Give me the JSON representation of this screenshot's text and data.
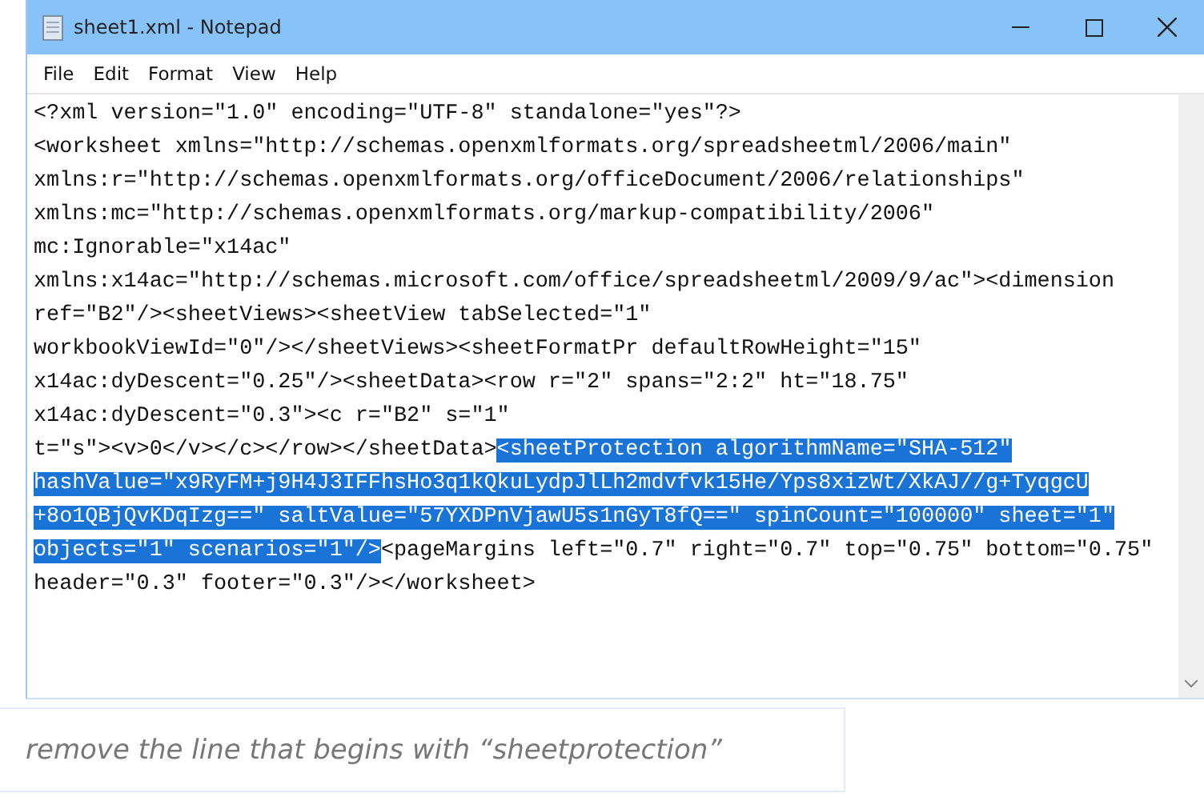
{
  "window": {
    "title": "sheet1.xml - Notepad"
  },
  "menu": [
    "File",
    "Edit",
    "Format",
    "View",
    "Help"
  ],
  "lines": [
    [
      {
        "text": "<?xml version=\"1.0\" encoding=\"UTF-8\" standalone=\"yes\"?>",
        "selected": false
      }
    ],
    [
      {
        "text": "<worksheet xmlns=\"http://schemas.openxmlformats.org/spreadsheetml/2006/main\"",
        "selected": false
      }
    ],
    [
      {
        "text": "xmlns:r=\"http://schemas.openxmlformats.org/officeDocument/2006/relationships\"",
        "selected": false
      }
    ],
    [
      {
        "text": "xmlns:mc=\"http://schemas.openxmlformats.org/markup-compatibility/2006\"",
        "selected": false
      }
    ],
    [
      {
        "text": "mc:Ignorable=\"x14ac\"",
        "selected": false
      }
    ],
    [
      {
        "text": "xmlns:x14ac=\"http://schemas.microsoft.com/office/spreadsheetml/2009/9/ac\"><dimension",
        "selected": false
      }
    ],
    [
      {
        "text": "ref=\"B2\"/><sheetViews><sheetView tabSelected=\"1\"",
        "selected": false
      }
    ],
    [
      {
        "text": "workbookViewId=\"0\"/></sheetViews><sheetFormatPr defaultRowHeight=\"15\"",
        "selected": false
      }
    ],
    [
      {
        "text": "x14ac:dyDescent=\"0.25\"/><sheetData><row r=\"2\" spans=\"2:2\" ht=\"18.75\"",
        "selected": false
      }
    ],
    [
      {
        "text": "x14ac:dyDescent=\"0.3\"><c r=\"B2\" s=\"1\"",
        "selected": false
      }
    ],
    [
      {
        "text": "t=\"s\"><v>0</v></c></row></sheetData>",
        "selected": false
      },
      {
        "text": "<sheetProtection algorithmName=\"SHA-512\"",
        "selected": true
      }
    ],
    [
      {
        "text": "hashValue=\"x9RyFM+j9H4J3IFFhsHo3q1kQkuLydpJlLh2mdvfvk15He/Yps8xizWt/XkAJ//g+TyqgcU",
        "selected": true
      }
    ],
    [
      {
        "text": "+8o1QBjQvKDqIzg==\" saltValue=\"57YXDPnVjawU5s1nGyT8fQ==\" spinCount=\"100000\" sheet=\"1\"",
        "selected": true
      }
    ],
    [
      {
        "text": "objects=\"1\" scenarios=\"1\"/>",
        "selected": true
      },
      {
        "text": "<pageMargins left=\"0.7\" right=\"0.7\" top=\"0.75\" bottom=\"0.75\"",
        "selected": false
      }
    ],
    [
      {
        "text": "header=\"0.3\" footer=\"0.3\"/></worksheet>",
        "selected": false
      }
    ]
  ],
  "caption": "remove the line that begins with “sheetprotection”"
}
